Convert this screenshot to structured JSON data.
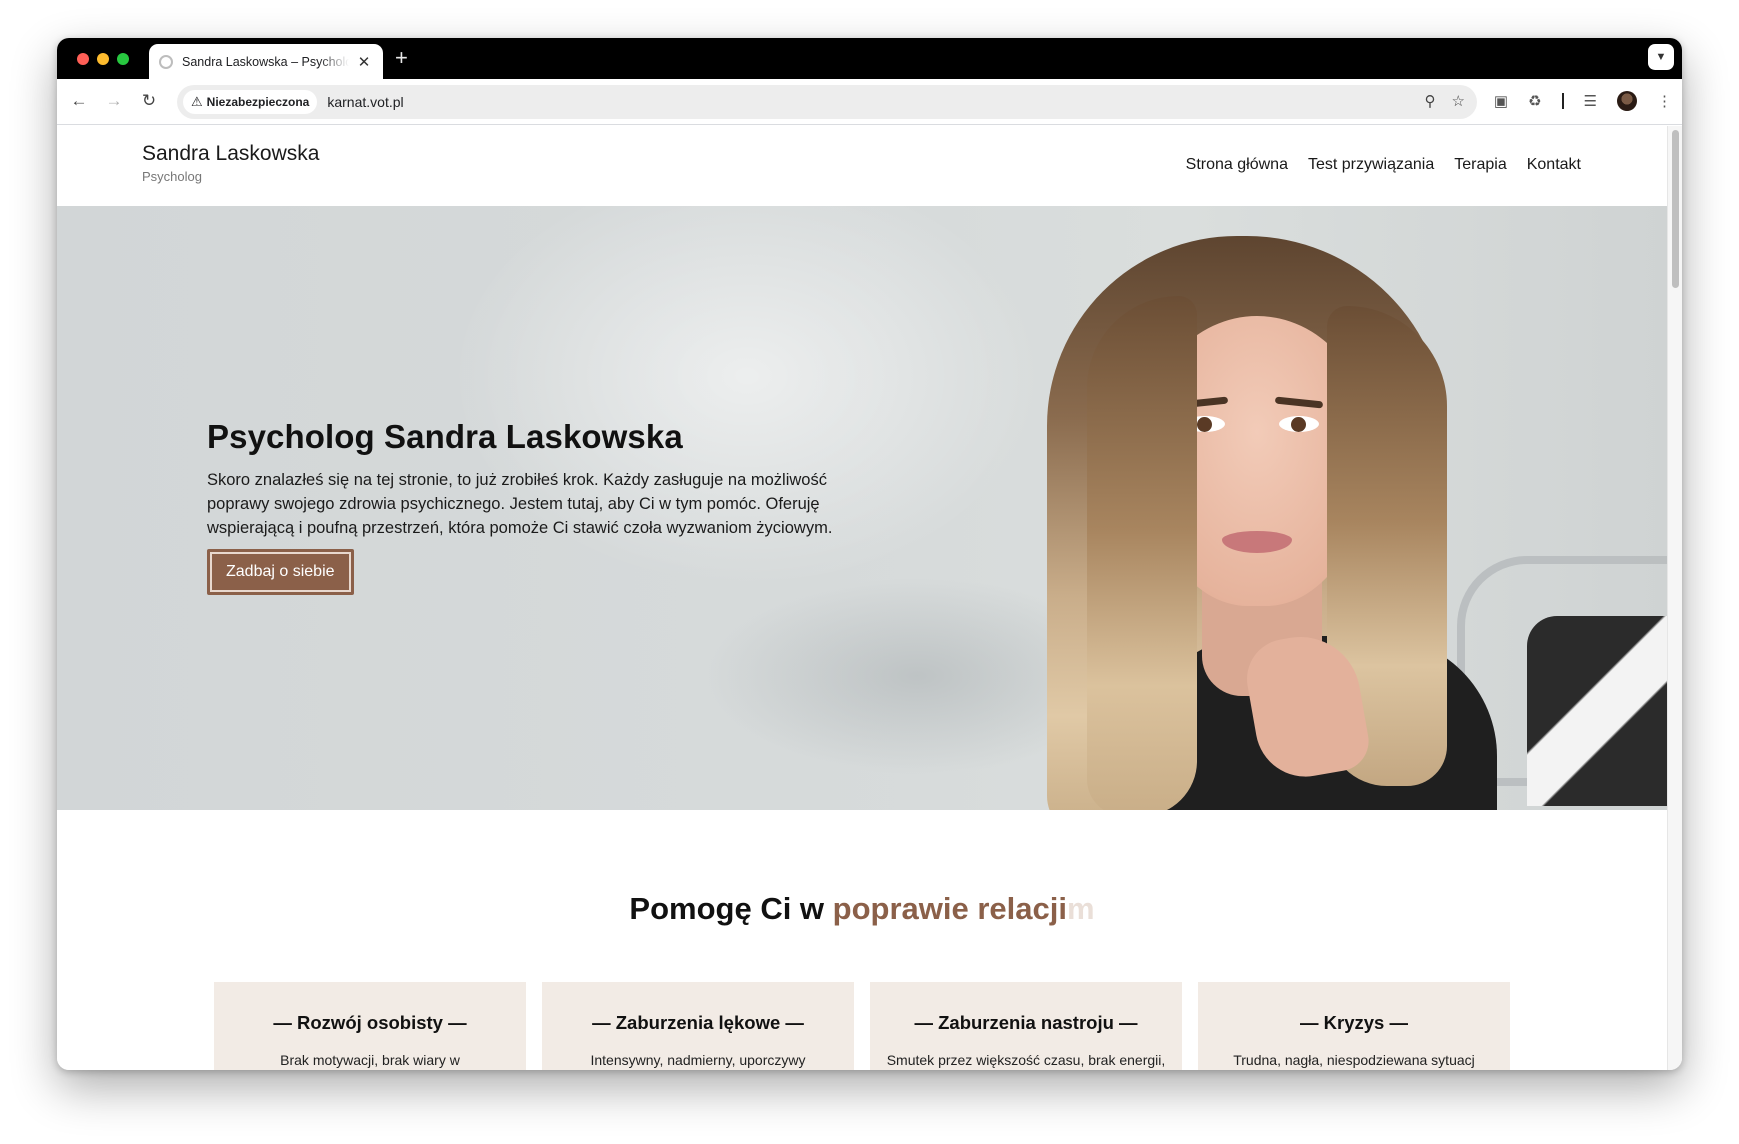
{
  "browser": {
    "tab": {
      "title": "Sandra Laskowska – Psycholog",
      "close": "✕"
    },
    "new_tab": "+",
    "security_label": "Niezabezpieczona",
    "url": "karnat.vot.pl"
  },
  "site": {
    "name": "Sandra Laskowska",
    "tagline": "Psycholog",
    "menu": [
      "Strona główna",
      "Test przywiązania",
      "Terapia",
      "Kontakt"
    ]
  },
  "hero": {
    "title": "Psycholog Sandra Laskowska",
    "description": "Skoro znalazłeś się na tej stronie, to już zrobiłeś krok. Każdy zasługuje na możliwość poprawy swojego zdrowia psychicznego. Jestem tutaj, aby Ci w tym pomóc. Oferuję wspierającą i poufną przestrzeń, która pomoże Ci stawić czoła wyzwaniom życiowym.",
    "button": "Zadbaj o siebie"
  },
  "help": {
    "prefix": "Pomogę Ci w ",
    "accent": "poprawie relacji",
    "ghost": "m"
  },
  "cards": [
    {
      "title": "— Rozwój osobisty —",
      "text": "Brak motywacji, brak wiary w"
    },
    {
      "title": "— Zaburzenia lękowe —",
      "text": "Intensywny, nadmierny, uporczywy"
    },
    {
      "title": "— Zaburzenia nastroju —",
      "text": "Smutek przez większość czasu, brak energii,"
    },
    {
      "title": "— Kryzys —",
      "text": "Trudna, nagła, niespodziewana sytuacj"
    }
  ],
  "colors": {
    "accent": "#8b6049",
    "card_bg": "#f2ebe5",
    "hero_bg": "#d3d7d8"
  }
}
